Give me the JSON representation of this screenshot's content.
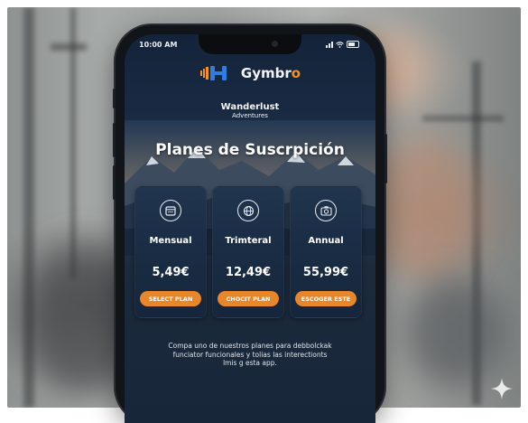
{
  "status_bar": {
    "time": "10:00 AM"
  },
  "brand": {
    "name_main": "Gymbr",
    "name_accent": "o",
    "accent_color": "#f0932b"
  },
  "hero": {
    "line1": "Wanderlust",
    "line2": "Adventures",
    "title": "Planes de Suscrpición"
  },
  "plans": [
    {
      "icon": "calendar-icon",
      "name": "Mensual",
      "price": "5,49€",
      "button": "SELECT PLAN"
    },
    {
      "icon": "globe-icon",
      "name": "Trimteral",
      "price": "12,49€",
      "button": "CHOCIT PLAN"
    },
    {
      "icon": "camera-icon",
      "name": "Annual",
      "price": "55,99€",
      "button": "ESCOGER ESTE"
    }
  ],
  "footer": {
    "line1": "Compa uno de nuestros planes para debbolckak",
    "line2": "funciator funcionales y tolias las interectionts",
    "line3": "lmis g esta app."
  },
  "colors": {
    "button": "#e8862a",
    "card": "#20344e",
    "screen_bg": "#1a2c44"
  }
}
